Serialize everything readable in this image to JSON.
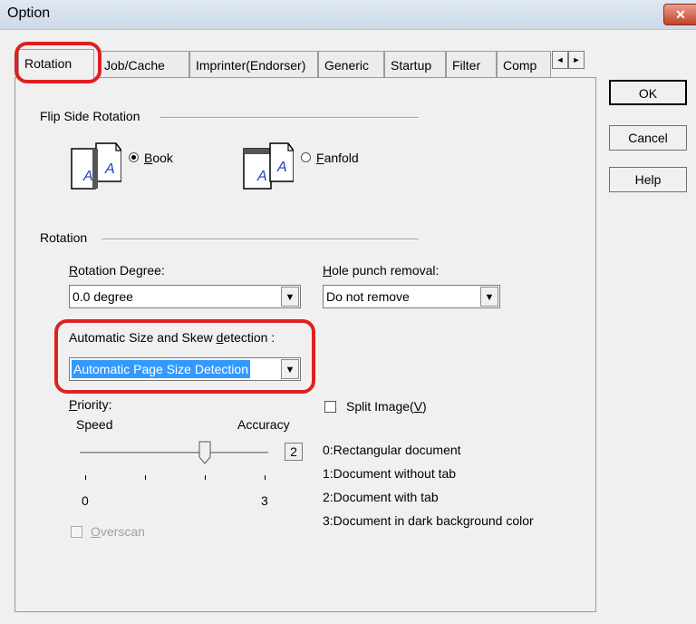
{
  "window": {
    "title": "Option",
    "close_glyph": "✕"
  },
  "tabs": [
    {
      "label": "Rotation"
    },
    {
      "label": "Job/Cache"
    },
    {
      "label": "Imprinter(Endorser)"
    },
    {
      "label": "Generic"
    },
    {
      "label": "Startup"
    },
    {
      "label": "Filter"
    },
    {
      "label": "Comp"
    }
  ],
  "tab_scroll": {
    "left": "◄",
    "right": "►"
  },
  "buttons": {
    "ok": "OK",
    "cancel": "Cancel",
    "help": "Help"
  },
  "flip_side": {
    "heading": "Flip Side Rotation",
    "options": [
      {
        "mnemonic": "B",
        "rest": "ook",
        "checked": true
      },
      {
        "mnemonic": "F",
        "rest": "anfold",
        "checked": false
      }
    ]
  },
  "rotation": {
    "heading": "Rotation",
    "degree_label": {
      "mnemonic": "R",
      "rest": "otation Degree:"
    },
    "degree_value": "0.0 degree",
    "hole_label": {
      "mnemonic": "H",
      "rest": "ole punch removal:"
    },
    "hole_value": "Do not remove",
    "auto_label": {
      "before": "Automatic Size and Skew ",
      "mnemonic": "d",
      "after": "etection :"
    },
    "auto_value": "Automatic Page Size Detection",
    "priority_label": {
      "mnemonic": "P",
      "rest": "riority:"
    },
    "speed": "Speed",
    "accuracy": "Accuracy",
    "slider_value": "2",
    "slider_level": 2,
    "slider_min": "0",
    "slider_max": "3",
    "split_label": {
      "before": "Split Image(",
      "mnemonic": "V",
      "after": ")"
    },
    "split_checked": false,
    "overscan_label": {
      "mnemonic": "O",
      "rest": "verscan"
    },
    "legend": [
      "0:Rectangular document",
      "1:Document without tab",
      "2:Document with tab",
      "3:Document in dark background color"
    ]
  },
  "colors": {
    "highlight": "#e02020",
    "selection": "#3399ff",
    "page_icon_letter": "#1f3fbf"
  },
  "dropdown_arrow": "▼",
  "page_icon_letter": "A"
}
